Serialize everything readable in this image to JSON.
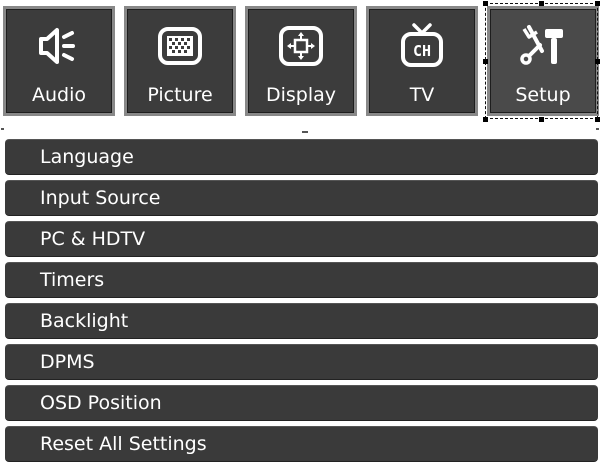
{
  "tabs": [
    {
      "label": "Audio",
      "icon": "speaker-icon"
    },
    {
      "label": "Picture",
      "icon": "picture-icon"
    },
    {
      "label": "Display",
      "icon": "display-position-icon"
    },
    {
      "label": "TV",
      "icon": "tv-channel-icon"
    },
    {
      "label": "Setup",
      "icon": "tools-icon",
      "selected": true
    }
  ],
  "tv_icon_text": "CH",
  "menu": {
    "items": [
      "Language",
      "Input Source",
      "PC & HDTV",
      "Timers",
      "Backlight",
      "DPMS",
      "OSD Position",
      "Reset All Settings"
    ]
  },
  "colors": {
    "tab_background": "#3c3c3c",
    "tab_border": "#888888",
    "menu_item_background": "#3a3a3a",
    "text": "#ffffff"
  }
}
